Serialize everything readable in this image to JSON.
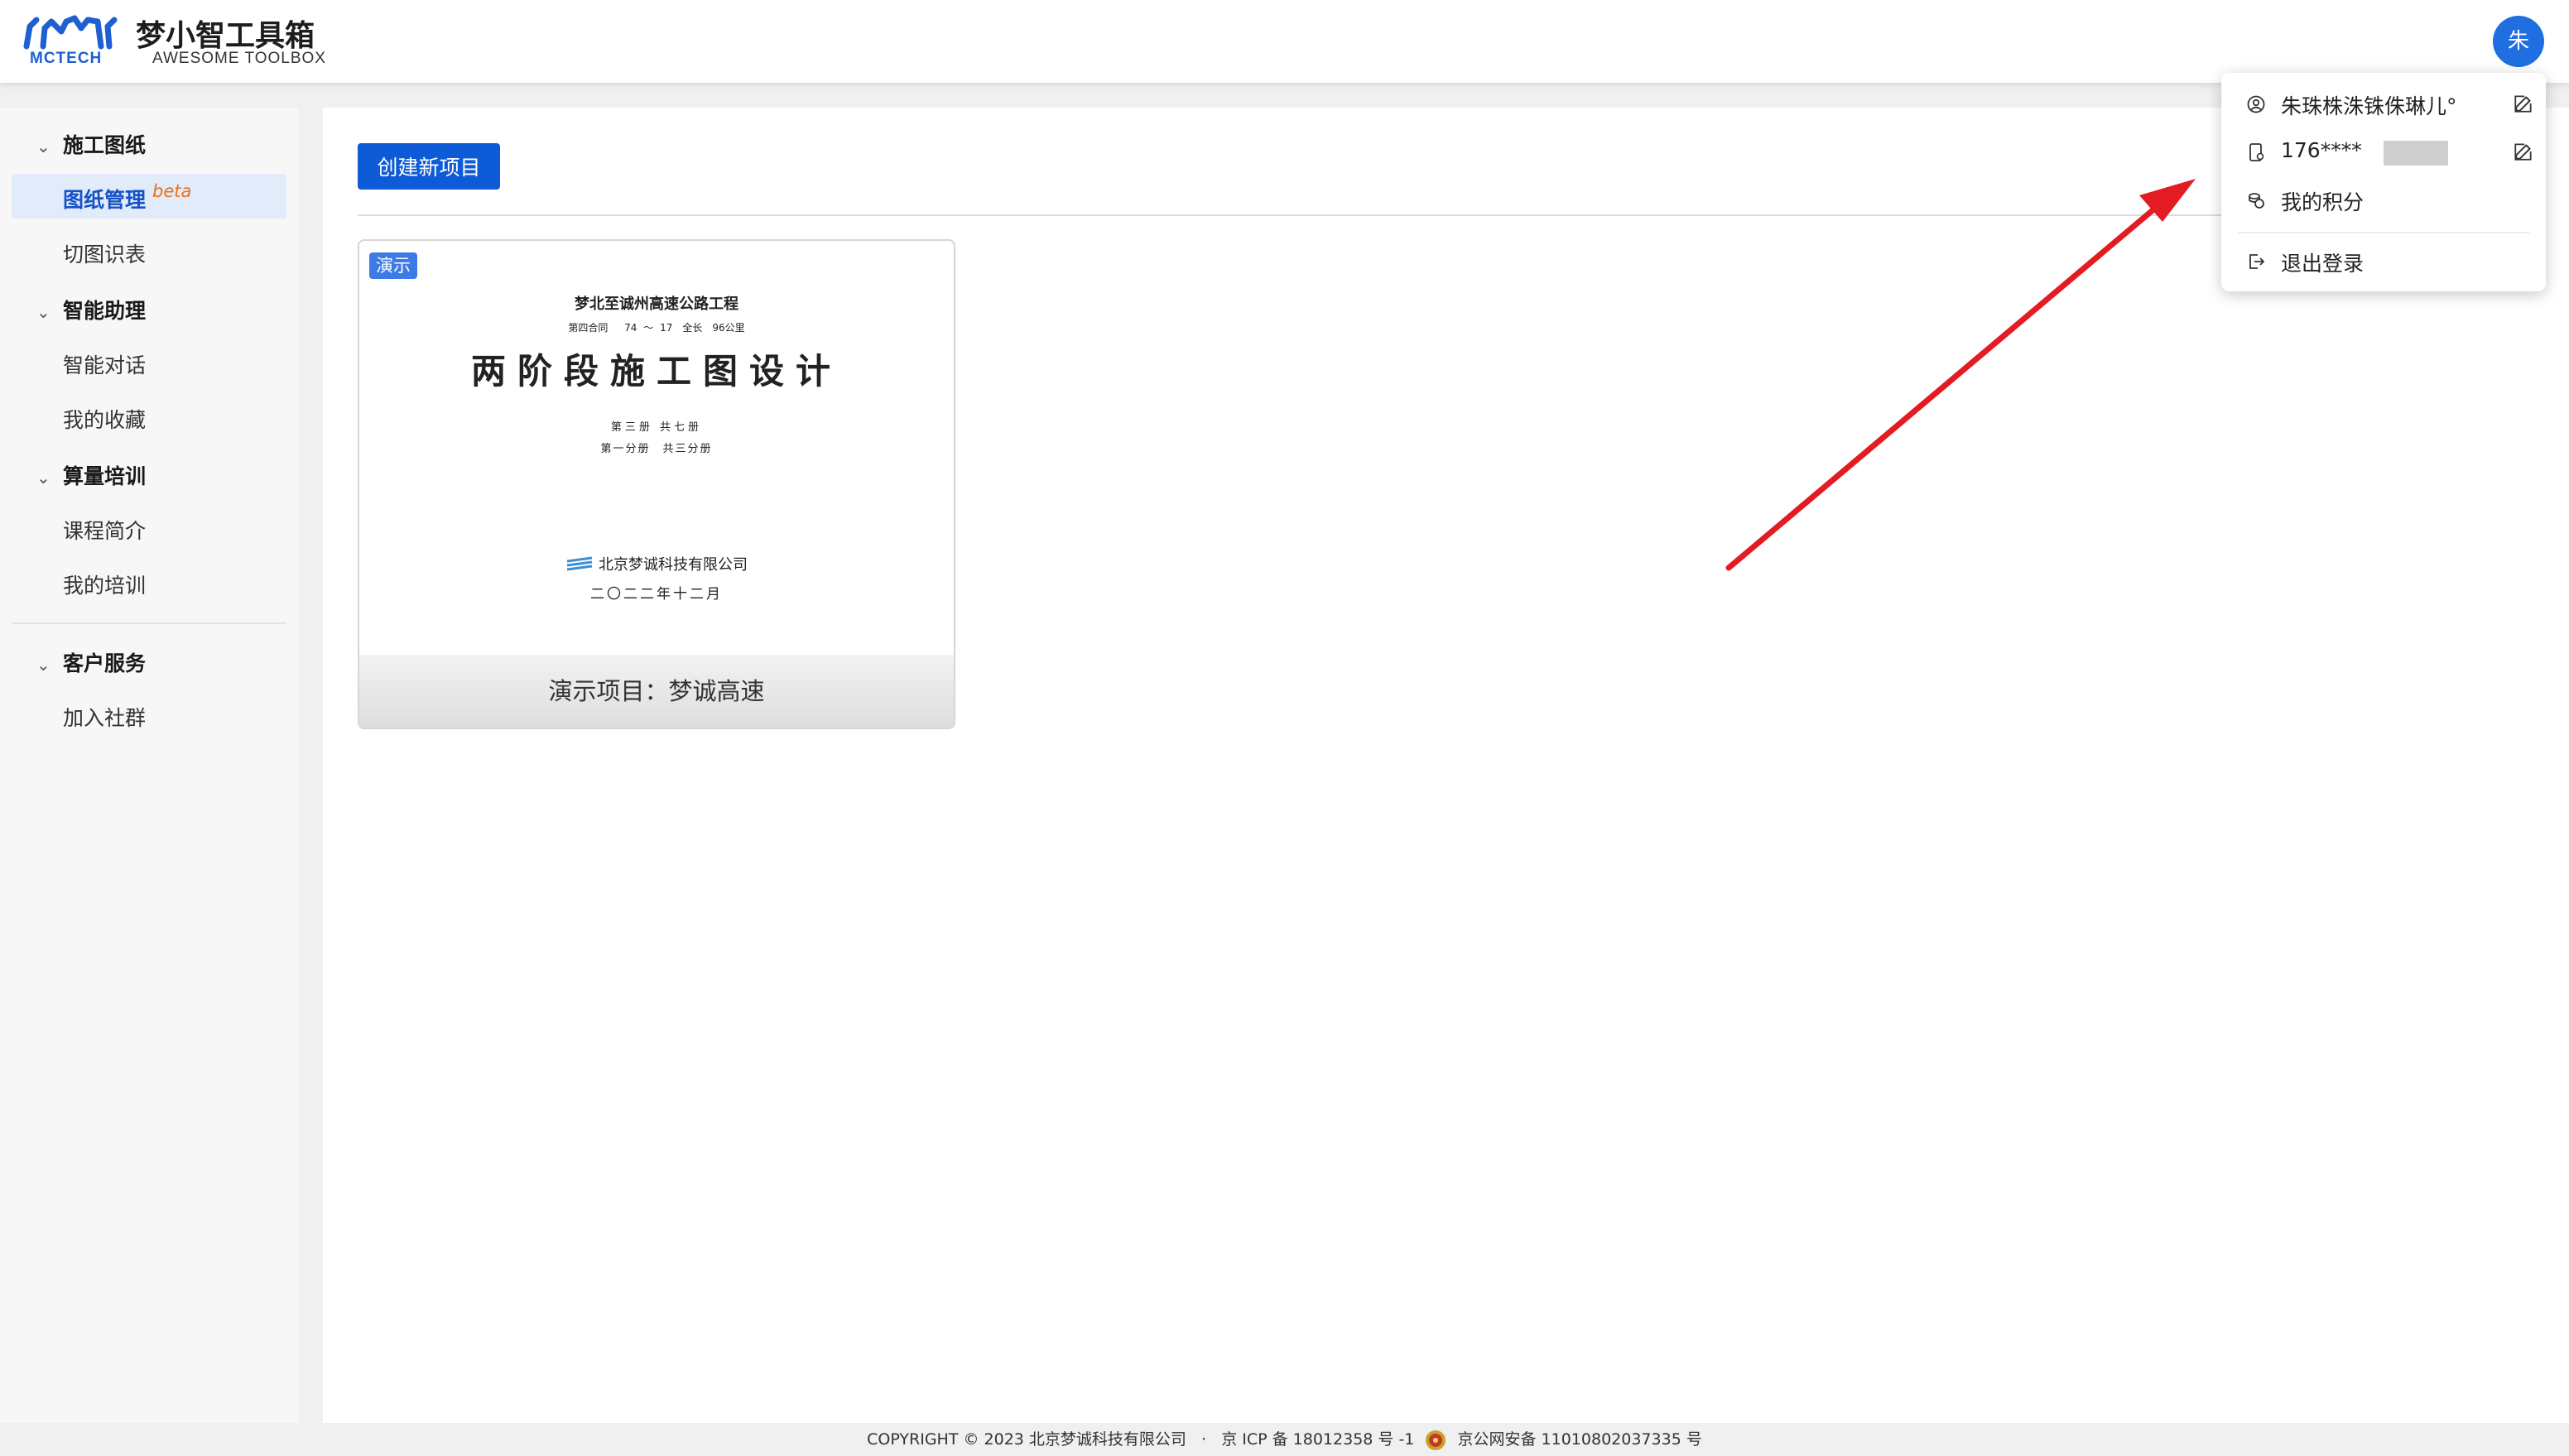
{
  "header": {
    "logo_text": "MCTECH",
    "title": "梦小智工具箱",
    "subtitle": "AWESOME TOOLBOX",
    "avatar_initial": "朱"
  },
  "sidebar": {
    "groups": [
      {
        "label": "施工图纸",
        "items": [
          {
            "label": "图纸管理",
            "badge": "beta",
            "active": true
          },
          {
            "label": "切图识表"
          }
        ]
      },
      {
        "label": "智能助理",
        "items": [
          {
            "label": "智能对话"
          },
          {
            "label": "我的收藏"
          }
        ]
      },
      {
        "label": "算量培训",
        "items": [
          {
            "label": "课程简介"
          },
          {
            "label": "我的培训"
          }
        ]
      },
      {
        "label": "客户服务",
        "items": [
          {
            "label": "加入社群"
          }
        ]
      }
    ]
  },
  "main": {
    "create_button": "创建新项目",
    "card": {
      "badge": "演示",
      "cover": {
        "line1": "梦北至诚州高速公路工程",
        "line2": "第四合同　 74 ～ 17　全长　96公里",
        "title": "两阶段施工图设计",
        "line4": "第三册 共七册",
        "line5": "第一分册　共三分册",
        "company": "北京梦诚科技有限公司",
        "date": "二〇二二年十二月"
      },
      "caption": "演示项目：梦诚高速"
    }
  },
  "user_menu": {
    "username": "朱珠株洙铢侏琳儿°",
    "phone": "176****",
    "points": "我的积分",
    "logout": "退出登录"
  },
  "footer": {
    "copyright": "COPYRIGHT © 2023 北京梦诚科技有限公司",
    "separator": "·",
    "icp": "京 ICP 备 18012358 号 -1",
    "police": "京公网安备 11010802037335 号"
  },
  "colors": {
    "primary": "#0d5bd7",
    "active_bg": "#e2ebf9",
    "beta": "#e8721b",
    "arrow": "#e31b23",
    "avatar": "#1f6fe0"
  }
}
